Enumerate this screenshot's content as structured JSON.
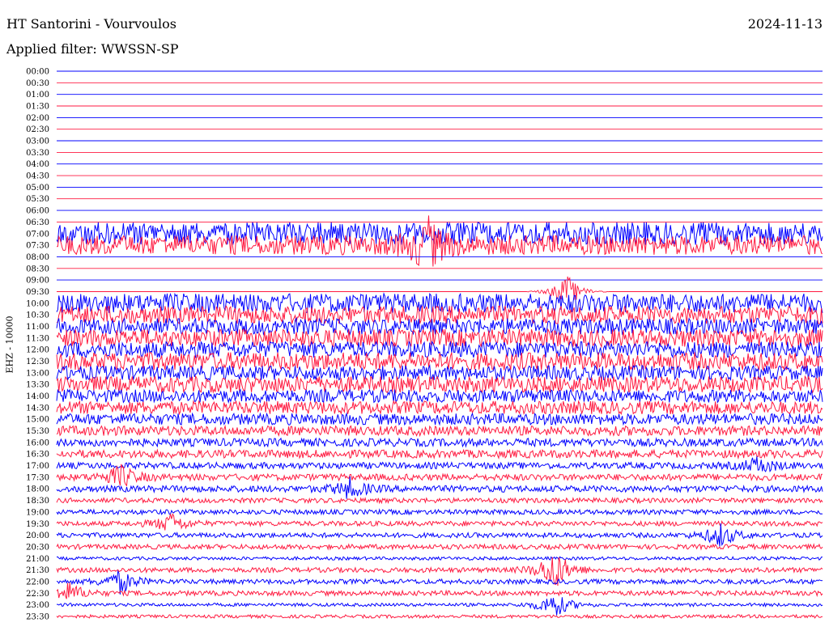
{
  "header": {
    "station": "HT Santorini - Vourvoulos",
    "date": "2024-11-13",
    "filter": "Applied filter: WWSSN-SP"
  },
  "colors": {
    "odd_trace": "#0000ff",
    "even_trace": "#ff1a40"
  },
  "chart_data": {
    "type": "helicorder",
    "title": "HT Santorini - Vourvoulos",
    "subtitle": "Applied filter: WWSSN-SP",
    "ylabel": "EHZ - 10000",
    "xlabel": "",
    "legend": "none",
    "grid": false,
    "series": [
      {
        "time": "00:00",
        "amplitude": 0
      },
      {
        "time": "00:30",
        "amplitude": 0
      },
      {
        "time": "01:00",
        "amplitude": 0
      },
      {
        "time": "01:30",
        "amplitude": 0
      },
      {
        "time": "02:00",
        "amplitude": 0
      },
      {
        "time": "02:30",
        "amplitude": 0
      },
      {
        "time": "03:00",
        "amplitude": 0
      },
      {
        "time": "03:30",
        "amplitude": 0
      },
      {
        "time": "04:00",
        "amplitude": 0
      },
      {
        "time": "04:30",
        "amplitude": 0
      },
      {
        "time": "05:00",
        "amplitude": 0
      },
      {
        "time": "05:30",
        "amplitude": 0
      },
      {
        "time": "06:00",
        "amplitude": 0
      },
      {
        "time": "06:30",
        "amplitude": 0
      },
      {
        "time": "07:00",
        "amplitude": 14
      },
      {
        "time": "07:30",
        "amplitude": 12
      },
      {
        "time": "08:00",
        "amplitude": 0
      },
      {
        "time": "08:30",
        "amplitude": 0
      },
      {
        "time": "09:00",
        "amplitude": 0
      },
      {
        "time": "09:30",
        "amplitude": 0
      },
      {
        "time": "10:00",
        "amplitude": 12
      },
      {
        "time": "10:30",
        "amplitude": 11
      },
      {
        "time": "11:00",
        "amplitude": 10
      },
      {
        "time": "11:30",
        "amplitude": 11
      },
      {
        "time": "12:00",
        "amplitude": 10
      },
      {
        "time": "12:30",
        "amplitude": 11
      },
      {
        "time": "13:00",
        "amplitude": 9
      },
      {
        "time": "13:30",
        "amplitude": 10
      },
      {
        "time": "14:00",
        "amplitude": 8
      },
      {
        "time": "14:30",
        "amplitude": 8
      },
      {
        "time": "15:00",
        "amplitude": 7
      },
      {
        "time": "15:30",
        "amplitude": 6
      },
      {
        "time": "16:00",
        "amplitude": 5
      },
      {
        "time": "16:30",
        "amplitude": 5
      },
      {
        "time": "17:00",
        "amplitude": 4
      },
      {
        "time": "17:30",
        "amplitude": 4
      },
      {
        "time": "18:00",
        "amplitude": 4
      },
      {
        "time": "18:30",
        "amplitude": 3
      },
      {
        "time": "19:00",
        "amplitude": 3
      },
      {
        "time": "19:30",
        "amplitude": 3
      },
      {
        "time": "20:00",
        "amplitude": 3
      },
      {
        "time": "20:30",
        "amplitude": 3
      },
      {
        "time": "21:00",
        "amplitude": 2
      },
      {
        "time": "21:30",
        "amplitude": 3
      },
      {
        "time": "22:00",
        "amplitude": 3
      },
      {
        "time": "22:30",
        "amplitude": 3
      },
      {
        "time": "23:00",
        "amplitude": 2
      },
      {
        "time": "23:30",
        "amplitude": 2
      }
    ],
    "events": [
      {
        "time": "07:30",
        "minute": 14.5,
        "strength": 30
      },
      {
        "time": "09:30",
        "minute": 20.0,
        "strength": 22
      },
      {
        "time": "17:00",
        "minute": 27.5,
        "strength": 10
      },
      {
        "time": "17:30",
        "minute": 2.5,
        "strength": 14
      },
      {
        "time": "18:00",
        "minute": 11.5,
        "strength": 12
      },
      {
        "time": "19:30",
        "minute": 4.5,
        "strength": 12
      },
      {
        "time": "20:00",
        "minute": 26.0,
        "strength": 14
      },
      {
        "time": "21:30",
        "minute": 19.5,
        "strength": 26
      },
      {
        "time": "22:00",
        "minute": 2.5,
        "strength": 14
      },
      {
        "time": "22:30",
        "minute": 0.5,
        "strength": 12
      },
      {
        "time": "23:00",
        "minute": 19.5,
        "strength": 16
      }
    ],
    "gaps": [
      {
        "time": "09:30",
        "from_minute": 0,
        "to_minute": 26
      }
    ]
  }
}
